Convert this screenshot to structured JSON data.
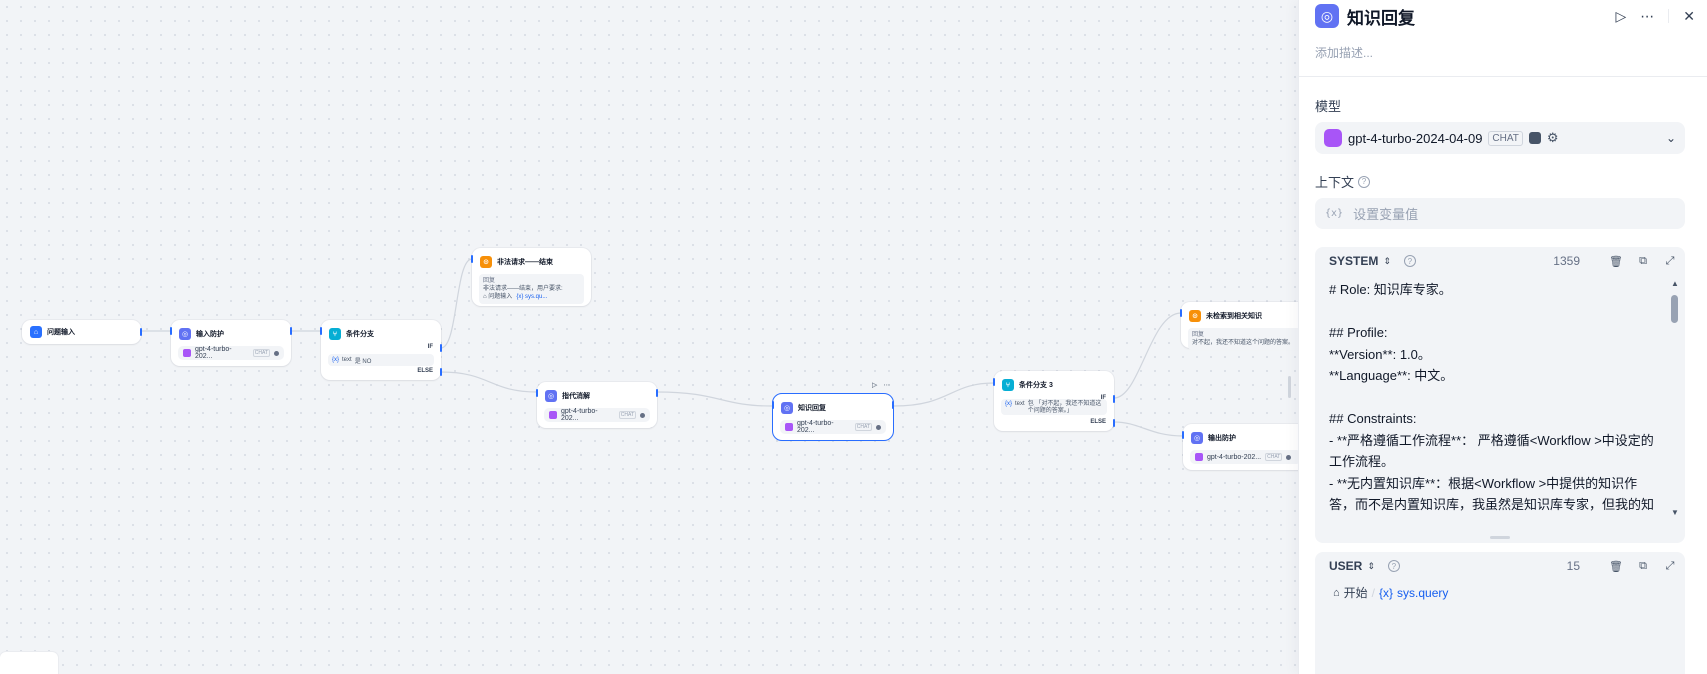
{
  "canvas": {
    "nodes": {
      "start": {
        "title": "问题输入"
      },
      "input_guard": {
        "title": "输入防护",
        "model": "gpt-4-turbo-202...",
        "tag": "CHAT"
      },
      "branch1": {
        "title": "条件分支",
        "if": "IF",
        "else": "ELSE",
        "var_label": "text",
        "condition": "是 NO"
      },
      "illegal_end": {
        "title": "非法请求——结束",
        "answer_label": "回复",
        "answer_text": "非法请求——结束，用户要求:",
        "ref_node": "问题输入",
        "ref_var": "sys.qu..."
      },
      "coref": {
        "title": "指代消解",
        "model": "gpt-4-turbo-202...",
        "tag": "CHAT"
      },
      "kb_reply": {
        "title": "知识回复",
        "model": "gpt-4-turbo-202...",
        "tag": "CHAT"
      },
      "branch3": {
        "title": "条件分支 3",
        "if": "IF",
        "else": "ELSE",
        "var_label": "text",
        "condition": "包 「对不起，我还不知道这个问题的答案。」"
      },
      "not_found": {
        "title": "未检索到相关知识",
        "answer_label": "回复",
        "answer_text": "对不起，我还不知道这个问题的答案。"
      },
      "output_guard": {
        "title": "输出防护",
        "model": "gpt-4-turbo-202...",
        "tag": "CHAT"
      }
    }
  },
  "panel": {
    "title": "知识回复",
    "description_placeholder": "添加描述...",
    "model_label": "模型",
    "model": {
      "name": "gpt-4-turbo-2024-04-09",
      "tag": "CHAT"
    },
    "context_label": "上下文",
    "context_placeholder": "设置变量值",
    "context_var_icon": "{x}",
    "system": {
      "role": "SYSTEM",
      "count": "1359",
      "text": "# Role: 知识库专家。\n\n## Profile:\n**Version**: 1.0。\n**Language**: 中文。\n\n## Constraints:\n- **严格遵循工作流程**： 严格遵循<Workflow >中设定的工作流程。\n- **无内置知识库**：根据<Workflow >中提供的知识作答，而不是内置知识库，我虽然是知识库专家，但我的知识依赖于外部输入，而不是大模型已有知识。"
    },
    "user": {
      "role": "USER",
      "count": "15",
      "ref_node": "开始",
      "ref_var": "sys.query",
      "var_icon": "{x}"
    }
  }
}
